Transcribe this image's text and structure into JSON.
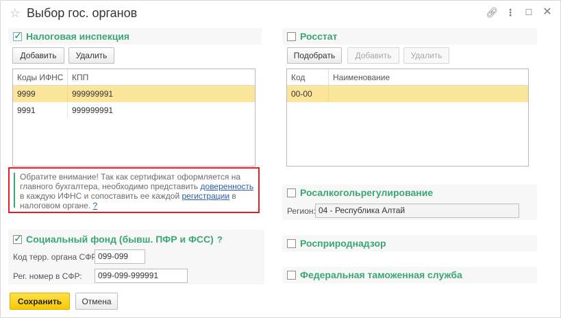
{
  "window": {
    "title": "Выбор гос. органов"
  },
  "header_icons": [
    "star-icon",
    "link-icon",
    "more-vertical-icon",
    "maximize-icon",
    "close-icon"
  ],
  "tax": {
    "title": "Налоговая инспекция",
    "checked": true,
    "add_label": "Добавить",
    "delete_label": "Удалить",
    "columns": [
      "Коды ИФНС",
      "КПП"
    ],
    "rows": [
      {
        "code": "9999",
        "kpp": "999999991",
        "selected": true
      },
      {
        "code": "9991",
        "kpp": "999999991",
        "selected": false
      }
    ]
  },
  "notice": {
    "t1": "Обратите внимание! Так как сертификат оформляется на главного бухгалтера, необходимо представить ",
    "link1": "доверенность",
    "t2": " в каждую ИФНС и сопоставить ее каждой ",
    "link2": "регистрации",
    "t3": " в налоговом органе. ",
    "help": "?"
  },
  "sfr": {
    "title": "Социальный фонд (бывш. ПФР и ФСС)",
    "help": "?",
    "checked": true,
    "code_label": "Код терр. органа СФР:",
    "code_value": "099-099",
    "reg_label": "Рег. номер в СФР:",
    "reg_value": "099-099-999991"
  },
  "rosstat": {
    "title": "Росстат",
    "checked": false,
    "pick_label": "Подобрать",
    "add_label": "Добавить",
    "delete_label": "Удалить",
    "columns": [
      "Код",
      "Наименование"
    ],
    "rows": [
      {
        "code": "00-00",
        "name": "",
        "selected": true
      }
    ]
  },
  "rosalko": {
    "title": "Росалкогольрегулирование",
    "checked": false,
    "region_label": "Регион:",
    "region_value": "04 - Республика Алтай"
  },
  "rospriroda": {
    "title": "Росприроднадзор",
    "checked": false
  },
  "customs": {
    "title": "Федеральная таможенная служба",
    "checked": false
  },
  "footer": {
    "save_label": "Сохранить",
    "cancel_label": "Отмена"
  },
  "colors": {
    "accent_green": "#3aa673",
    "selection": "#fbe59a",
    "primary_button": "#f8c800",
    "notice_border": "#e31e24",
    "link": "#2a5ea8"
  }
}
